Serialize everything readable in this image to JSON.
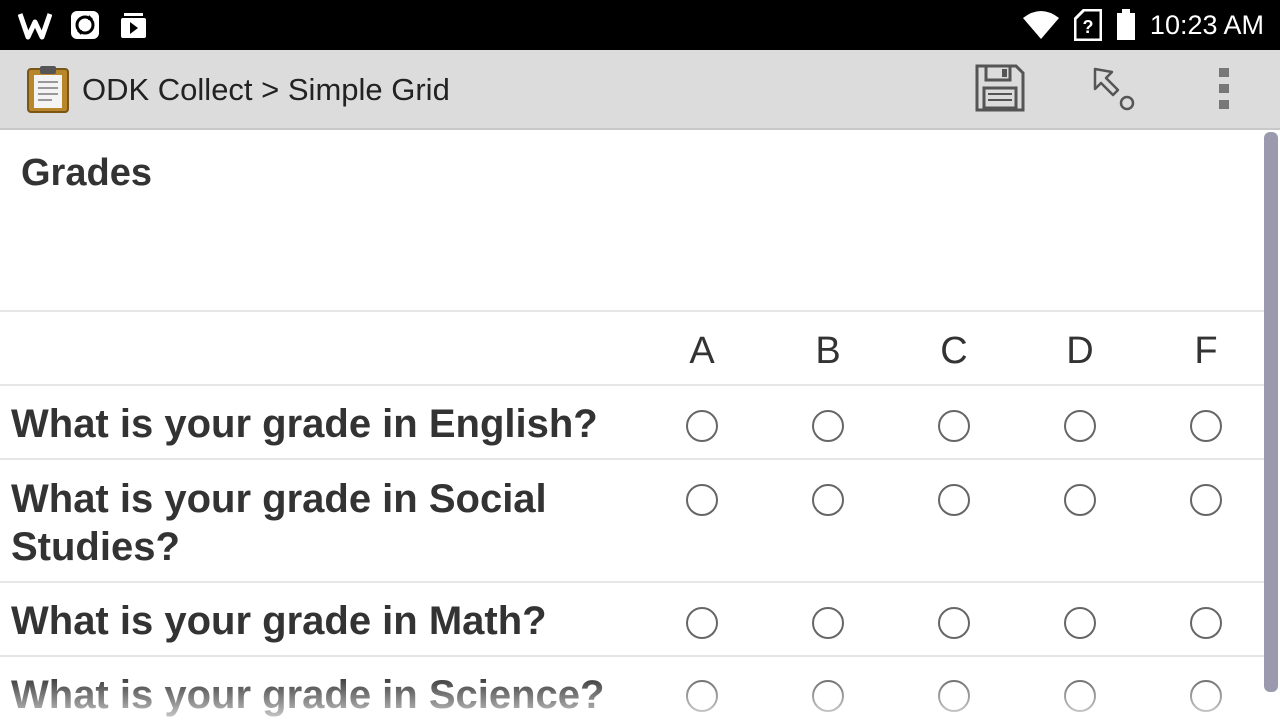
{
  "status_bar": {
    "time": "10:23 AM",
    "left_icons": [
      "w-app-icon",
      "sync-icon",
      "media-icon"
    ],
    "right_icons": [
      "wifi-icon",
      "no-sim-icon",
      "battery-icon"
    ]
  },
  "action_bar": {
    "title": "ODK Collect > Simple Grid",
    "app_icon": "clipboard-icon",
    "actions": [
      "save-icon",
      "jump-icon",
      "overflow-menu-icon"
    ]
  },
  "form": {
    "group_title": "Grades",
    "columns": [
      "A",
      "B",
      "C",
      "D",
      "F"
    ],
    "questions": [
      {
        "label": "What is your grade in English?"
      },
      {
        "label": "What is your grade in Social Studies?"
      },
      {
        "label": "What is your grade in Math?"
      },
      {
        "label": "What is your grade in Science?"
      }
    ]
  },
  "colors": {
    "status_bar_bg": "#000000",
    "action_bar_bg": "#dcdcdc",
    "scrollbar": "#9a9aae"
  }
}
